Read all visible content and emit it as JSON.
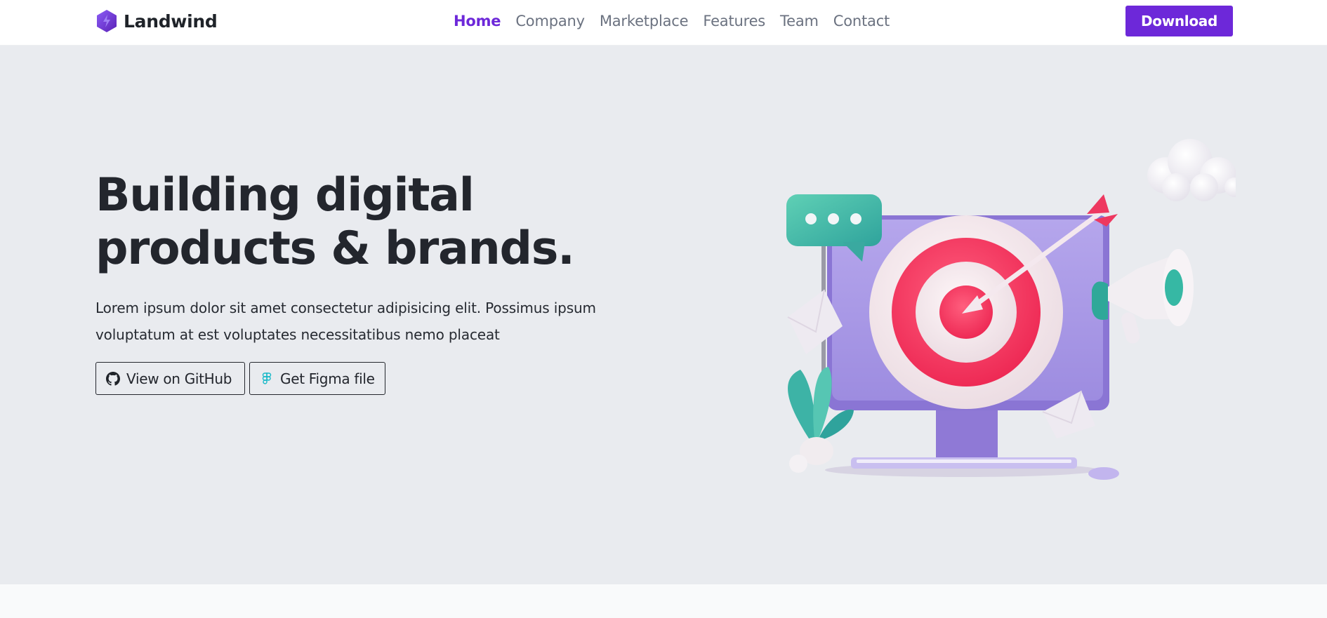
{
  "brand": {
    "name": "Landwind",
    "logo_icon": "hexagon-bolt-icon"
  },
  "nav": {
    "links": [
      {
        "label": "Home",
        "active": true
      },
      {
        "label": "Company",
        "active": false
      },
      {
        "label": "Marketplace",
        "active": false
      },
      {
        "label": "Features",
        "active": false
      },
      {
        "label": "Team",
        "active": false
      },
      {
        "label": "Contact",
        "active": false
      }
    ],
    "download_label": "Download"
  },
  "hero": {
    "title": "Building digital products & brands.",
    "description": "Lorem ipsum dolor sit amet consectetur adipisicing elit. Possimus ipsum voluptatum at est voluptates necessitatibus nemo placeat",
    "github_button": {
      "label": "View on GitHub",
      "icon": "github-icon"
    },
    "figma_button": {
      "label": "Get Figma file",
      "icon": "figma-icon"
    },
    "illustration": "target-monitor-illustration"
  },
  "colors": {
    "accent": "#6d28d9",
    "hero_background": "#e9ebef",
    "text_dark": "#23262d",
    "nav_text": "#6b7280"
  }
}
